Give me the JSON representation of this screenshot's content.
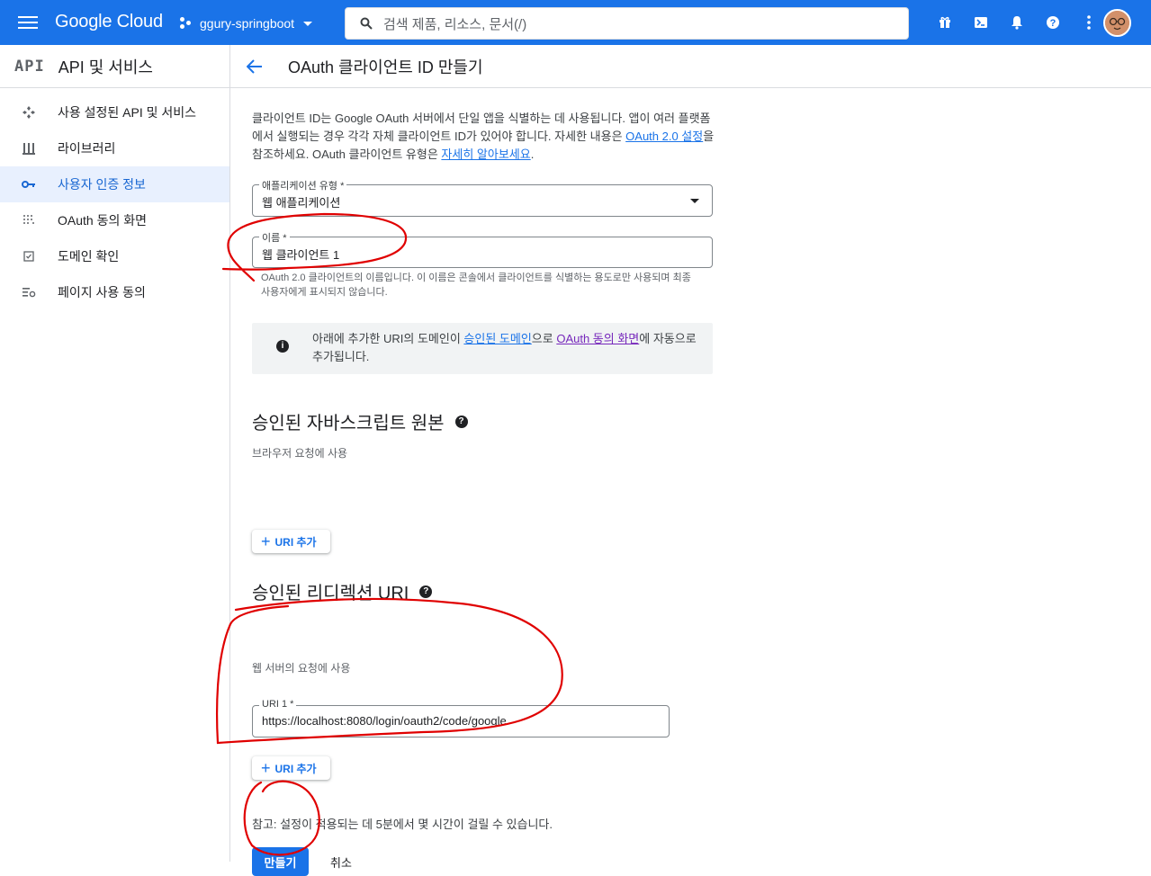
{
  "topbar": {
    "brand": "Google Cloud",
    "project": "ggury-springboot",
    "search_placeholder": "검색  제품, 리소스, 문서(/)",
    "accent": "#1a73e8"
  },
  "sidebar": {
    "logo": "API",
    "title": "API 및 서비스",
    "items": [
      {
        "label": "사용 설정된 API 및 서비스",
        "icon": "api-diamond-icon"
      },
      {
        "label": "라이브러리",
        "icon": "library-icon"
      },
      {
        "label": "사용자 인증 정보",
        "icon": "key-icon",
        "active": true
      },
      {
        "label": "OAuth 동의 화면",
        "icon": "consent-dots-icon"
      },
      {
        "label": "도메인 확인",
        "icon": "checkbox-icon"
      },
      {
        "label": "페이지 사용 동의",
        "icon": "settings-list-icon"
      }
    ]
  },
  "page": {
    "title": "OAuth 클라이언트 ID 만들기",
    "intro_1": "클라이언트 ID는 Google OAuth 서버에서 단일 앱을 식별하는 데 사용됩니다. 앱이 여러 플랫폼에서 실행되는 경우 각각 자체 클라이언트 ID가 있어야 합니다. 자세한 내용은 ",
    "intro_link_1": "OAuth 2.0 설정",
    "intro_2": "을 참조하세요. OAuth 클라이언트 유형은 ",
    "intro_link_2": "자세히 알아보세요",
    "intro_3": ".",
    "app_type_label": "애플리케이션 유형 *",
    "app_type_value": "웹 애플리케이션",
    "name_label": "이름 *",
    "name_value": "웹 클라이언트 1",
    "name_hint": "OAuth 2.0 클라이언트의 이름입니다. 이 이름은 콘솔에서 클라이언트를 식별하는 용도로만 사용되며 최종 사용자에게 표시되지 않습니다.",
    "info_1": "아래에 추가한 URI의 도메인이 ",
    "info_link_1": "승인된 도메인",
    "info_2": "으로 ",
    "info_link_2": "OAuth 동의 화면",
    "info_3": "에 자동으로 추가됩니다.",
    "js_origins_title": "승인된 자바스크립트 원본",
    "js_origins_sub": "브라우저 요청에 사용",
    "add_uri_label": "URI 추가",
    "redirect_title": "승인된 리디렉션 URI",
    "redirect_sub": "웹 서버의 요청에 사용",
    "uri1_label": "URI 1 *",
    "uri1_value": "https://localhost:8080/login/oauth2/code/google",
    "note": "참고: 설정이 적용되는 데 5분에서 몇 시간이 걸릴 수 있습니다.",
    "create_label": "만들기",
    "cancel_label": "취소"
  },
  "annotation_color": "#e00000"
}
